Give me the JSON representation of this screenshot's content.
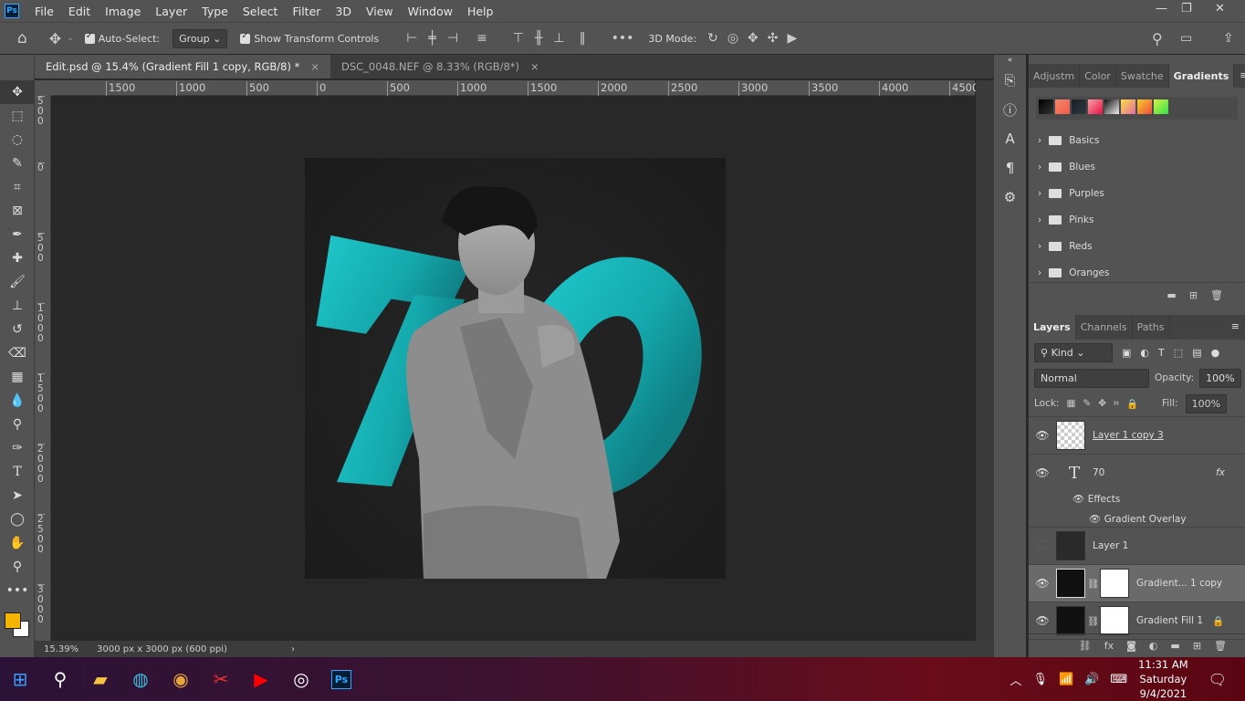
{
  "menubar": {
    "logo": "Ps",
    "items": [
      "File",
      "Edit",
      "Image",
      "Layer",
      "Type",
      "Select",
      "Filter",
      "3D",
      "View",
      "Window",
      "Help"
    ]
  },
  "options": {
    "auto_select_label": "Auto-Select:",
    "auto_select_target": "Group",
    "show_transform_label": "Show Transform Controls",
    "mode3d_label": "3D Mode:"
  },
  "tabs": [
    {
      "label": "Edit.psd @ 15.4% (Gradient Fill 1 copy, RGB/8) *",
      "active": true
    },
    {
      "label": "DSC_0048.NEF @ 8.33% (RGB/8*)",
      "active": false
    }
  ],
  "rulers": {
    "horizontal": [
      "1500",
      "1000",
      "500",
      "0",
      "500",
      "1000",
      "1500",
      "2000",
      "2500",
      "3000",
      "3500",
      "4000",
      "4500"
    ],
    "vertical": [
      "500",
      "0",
      "500",
      "1000",
      "1500",
      "2000",
      "2500",
      "3000"
    ]
  },
  "artwork": {
    "big_text": "70",
    "accent": "#1ec8cc"
  },
  "status": {
    "zoom": "15.39%",
    "doc_size": "3000 px x 3000 px (600 ppi)"
  },
  "gradients_panel": {
    "tabs": [
      "Adjustm",
      "Color",
      "Swatche",
      "Gradients"
    ],
    "active": "Gradients",
    "swatches": [
      "#000000",
      "#f26d5b",
      "#1a1f26",
      "#e8204a",
      "#c8c8c8",
      "#f7c843",
      "#f4a22d",
      "#8ae234"
    ],
    "folders": [
      "Basics",
      "Blues",
      "Purples",
      "Pinks",
      "Reds",
      "Oranges"
    ]
  },
  "layers_panel": {
    "tabs": [
      "Layers",
      "Channels",
      "Paths"
    ],
    "filter": "Kind",
    "blend_mode": "Normal",
    "opacity_label": "Opacity:",
    "opacity": "100%",
    "lock_label": "Lock:",
    "fill_label": "Fill:",
    "fill": "100%",
    "layers": [
      {
        "name": "Layer 1 copy 3",
        "visible": true
      },
      {
        "name": "70",
        "visible": true,
        "type": "text",
        "fx": "fx",
        "effects_label": "Effects",
        "effect": "Gradient Overlay"
      },
      {
        "name": "Layer 1",
        "visible": false
      },
      {
        "name": "Gradient... 1 copy",
        "visible": true,
        "selected": true
      },
      {
        "name": "Gradient Fill 1",
        "visible": true,
        "locked": true
      }
    ]
  },
  "taskbar": {
    "time": "11:31 AM",
    "day": "Saturday",
    "date": "9/4/2021"
  }
}
